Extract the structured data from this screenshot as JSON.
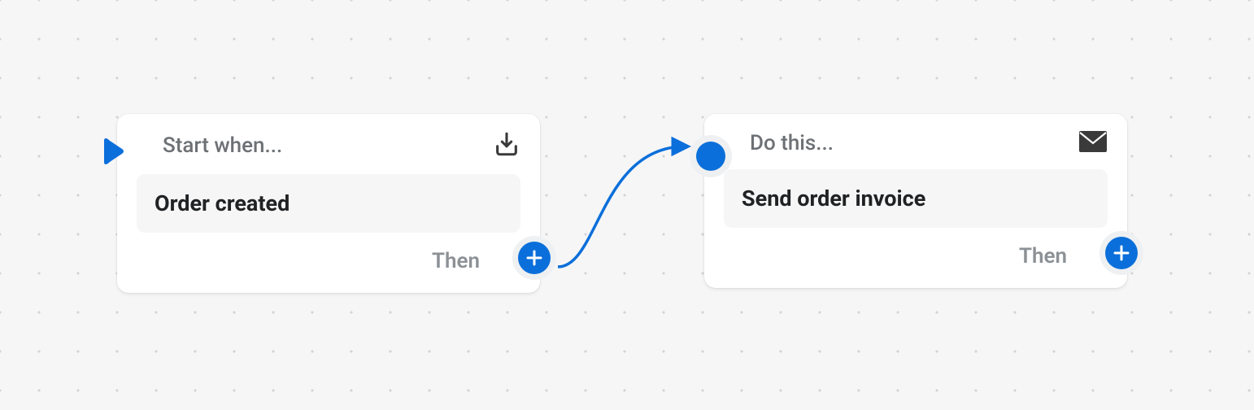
{
  "nodes": {
    "trigger": {
      "header": "Start when...",
      "content": "Order created",
      "footer": "Then",
      "icon": "import-box"
    },
    "action": {
      "header": "Do this...",
      "content": "Send order invoice",
      "footer": "Then",
      "icon": "mail"
    }
  },
  "colors": {
    "accent": "#0a6fda"
  }
}
